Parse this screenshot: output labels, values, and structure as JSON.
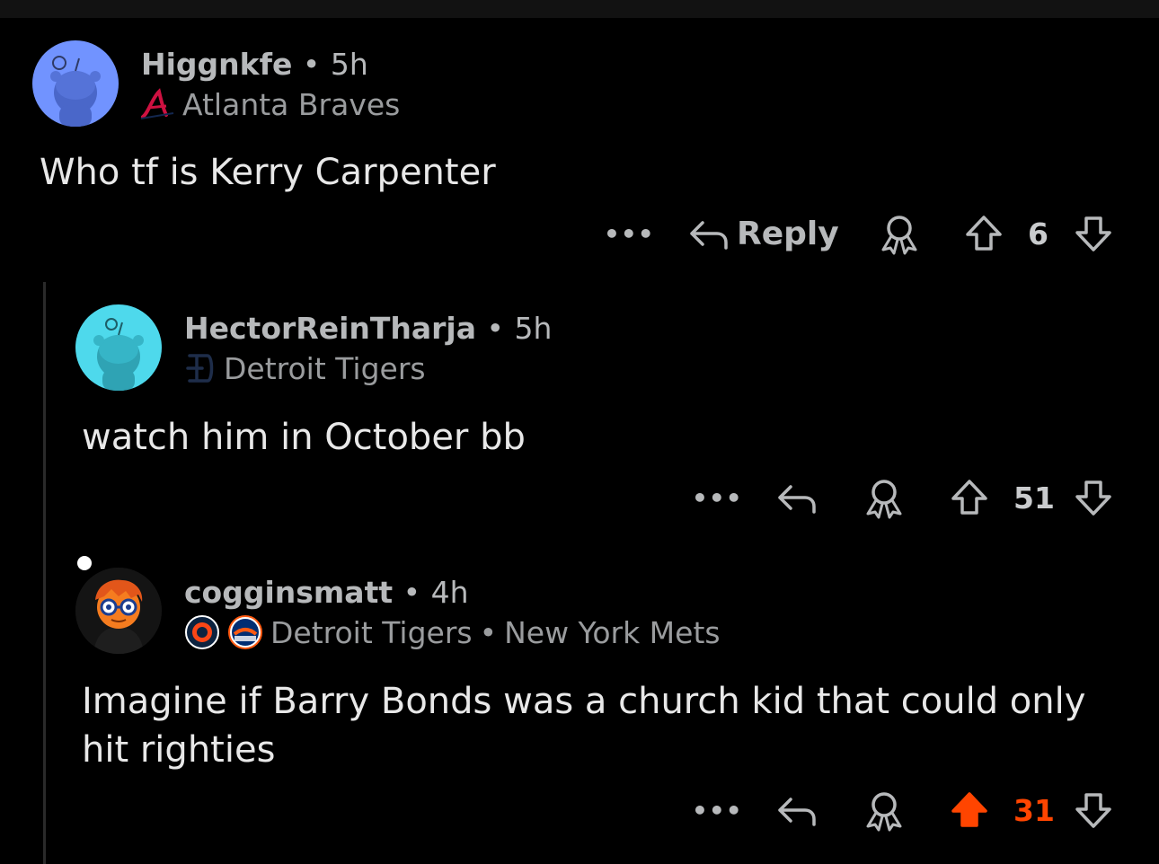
{
  "comments": [
    {
      "username": "Higgnkfe",
      "time": "5h",
      "flair_primary": "Atlanta Braves",
      "flair_icon": "braves-logo-icon",
      "avatar_color": "#7193ff",
      "body": "Who tf is Kerry Carpenter",
      "reply_label": "Reply",
      "score": "6",
      "upvoted": false
    },
    {
      "username": "HectorReinTharja",
      "time": "5h",
      "flair_primary": "Detroit Tigers",
      "flair_icon": "tigers-logo-icon",
      "avatar_color": "#4ed9ec",
      "body": "watch him in October bb",
      "score": "51",
      "upvoted": false
    },
    {
      "username": "cogginsmatt",
      "time": "4h",
      "flair_primary": "Detroit Tigers",
      "flair_secondary": "New York Mets",
      "flair_icon": "tigers-badge-icon",
      "flair_icon_2": "mets-badge-icon",
      "body_line1": "Imagine if Barry Bonds was a church kid that could only",
      "body_line2": "hit righties",
      "score": "31",
      "upvoted": true,
      "upvote_color": "#ff4500"
    }
  ],
  "separator": "•",
  "more_label": "•••"
}
